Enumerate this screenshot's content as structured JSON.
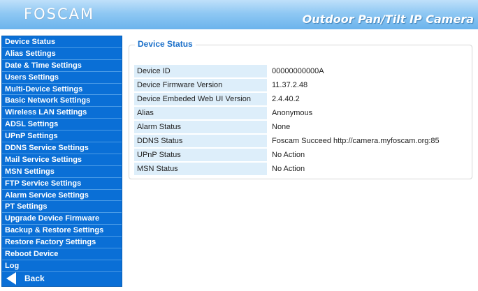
{
  "header": {
    "brand": "FOSCAM",
    "product": "Outdoor Pan/Tilt IP Camera"
  },
  "sidebar": {
    "items": [
      {
        "label": "Device Status"
      },
      {
        "label": "Alias Settings"
      },
      {
        "label": "Date & Time Settings"
      },
      {
        "label": "Users Settings"
      },
      {
        "label": "Multi-Device Settings"
      },
      {
        "label": "Basic Network Settings"
      },
      {
        "label": "Wireless LAN Settings"
      },
      {
        "label": "ADSL Settings"
      },
      {
        "label": "UPnP Settings"
      },
      {
        "label": "DDNS Service Settings"
      },
      {
        "label": "Mail Service Settings"
      },
      {
        "label": "MSN Settings"
      },
      {
        "label": "FTP Service Settings"
      },
      {
        "label": "Alarm Service Settings"
      },
      {
        "label": "PT Settings"
      },
      {
        "label": "Upgrade Device Firmware"
      },
      {
        "label": "Backup & Restore Settings"
      },
      {
        "label": "Restore Factory Settings"
      },
      {
        "label": "Reboot Device"
      },
      {
        "label": "Log"
      }
    ],
    "back_label": "Back"
  },
  "main": {
    "section_title": "Device Status",
    "rows": [
      {
        "label": "Device ID",
        "value": "00000000000A"
      },
      {
        "label": "Device Firmware Version",
        "value": "11.37.2.48"
      },
      {
        "label": "Device Embeded Web UI Version",
        "value": "2.4.40.2"
      },
      {
        "label": "Alias",
        "value": "Anonymous"
      },
      {
        "label": "Alarm Status",
        "value": "None"
      },
      {
        "label": "DDNS Status",
        "value": "Foscam Succeed  http://camera.myfoscam.org:85"
      },
      {
        "label": "UPnP Status",
        "value": "No Action"
      },
      {
        "label": "MSN Status",
        "value": "No Action"
      }
    ]
  }
}
